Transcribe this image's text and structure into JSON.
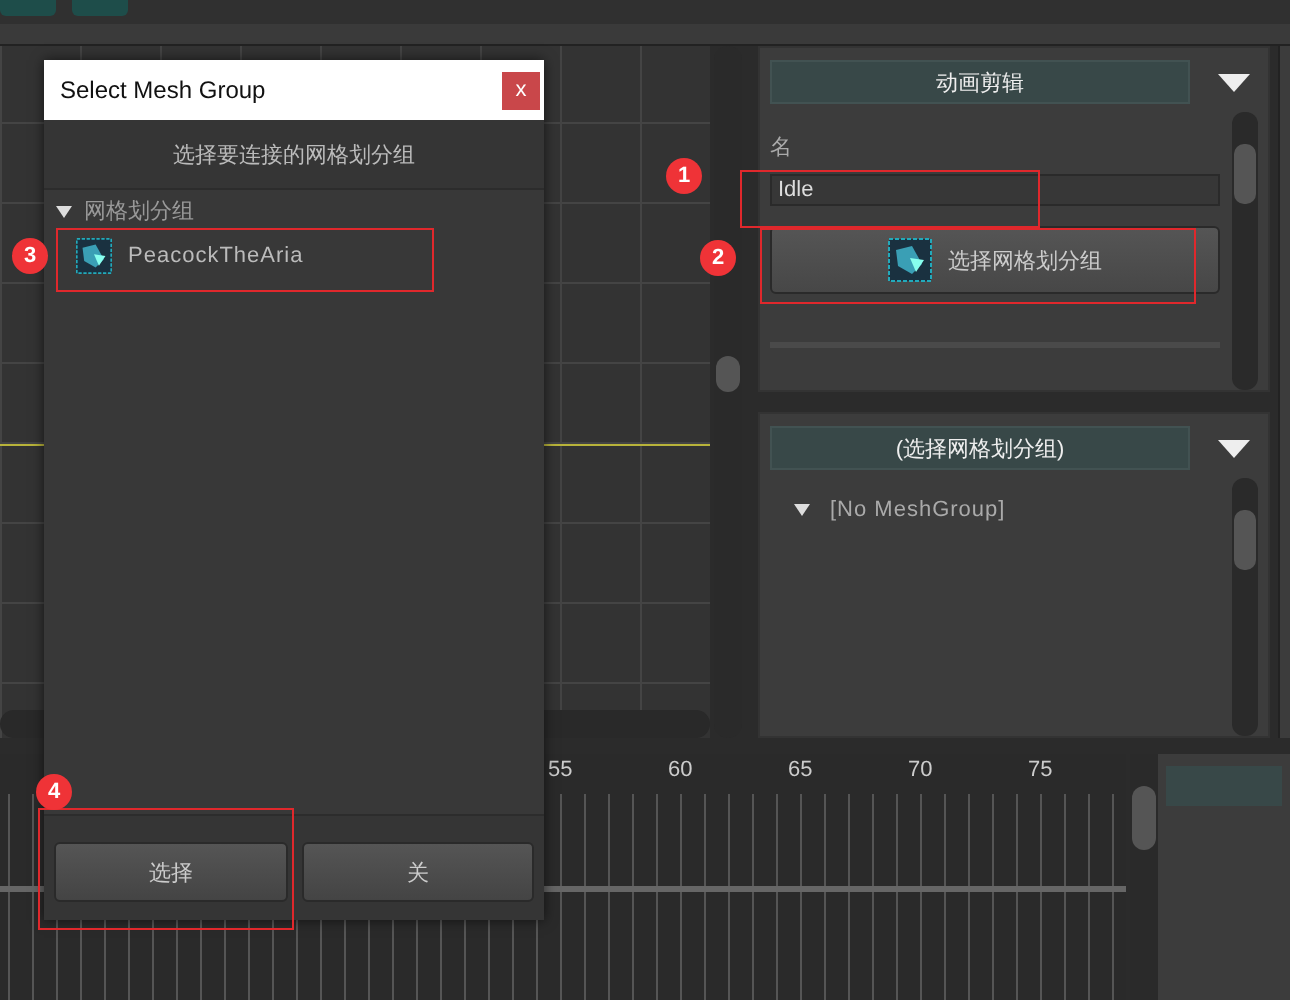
{
  "clip_panel": {
    "header": "动画剪辑",
    "name_label": "名",
    "name_value": "Idle",
    "mesh_button": "选择网格划分组"
  },
  "mesh_panel": {
    "header": "(选择网格划分组)",
    "tree": [
      {
        "label": "[No MeshGroup]",
        "expanded": true
      }
    ]
  },
  "timeline": {
    "ruler_labels": [
      "55",
      "60",
      "65",
      "70",
      "75"
    ]
  },
  "dialog": {
    "title": "Select Mesh Group",
    "close": "x",
    "prompt": "选择要连接的网格划分组",
    "tree": [
      {
        "label": "网格划分组",
        "expanded": true,
        "children": [
          {
            "label": "PeacockTheAria"
          }
        ]
      }
    ],
    "buttons": [
      "选择",
      "关"
    ]
  },
  "annotations": [
    "1",
    "2",
    "3",
    "4"
  ]
}
